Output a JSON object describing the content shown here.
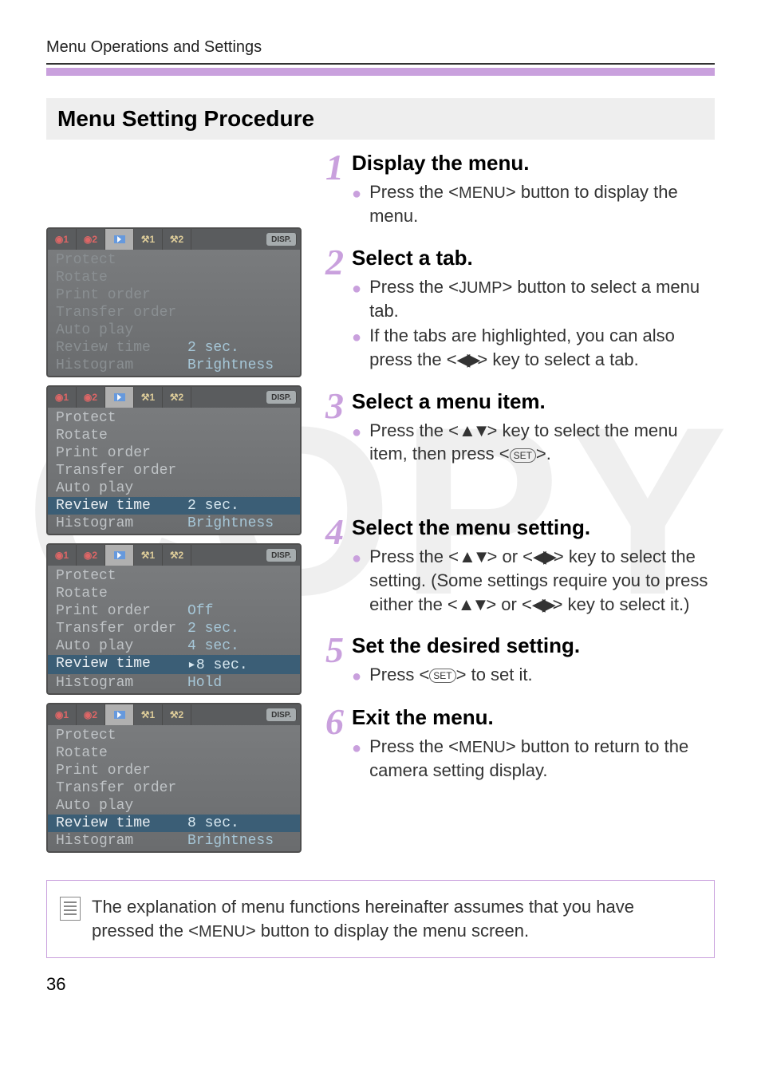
{
  "header": {
    "breadcrumb": "Menu Operations and Settings"
  },
  "section_title": "Menu Setting Procedure",
  "steps": [
    {
      "title": "Display the menu.",
      "bullets": [
        "Press the <MENU> button to display the menu."
      ]
    },
    {
      "title": "Select a tab.",
      "bullets": [
        "Press the <JUMP> button to select a menu tab.",
        "If the tabs are highlighted, you can also press the <◀▶> key to select a tab."
      ]
    },
    {
      "title": "Select a menu item.",
      "bullets": [
        "Press the <▲▼> key to select the menu item, then press <SET>."
      ]
    },
    {
      "title": "Select the menu setting.",
      "bullets": [
        "Press the <▲▼> or <◀▶> key to select the setting. (Some settings require you to press either the <▲▼> or <◀▶> key to select it.)"
      ]
    },
    {
      "title": "Set the desired setting.",
      "bullets": [
        "Press <SET> to set it."
      ]
    },
    {
      "title": "Exit the menu.",
      "bullets": [
        "Press the <MENU> button to return to the camera setting display."
      ]
    }
  ],
  "tabs": {
    "labels": [
      "📷1",
      "📷2",
      "▶",
      "⚙1",
      "⚙2"
    ],
    "disp_label": "DISP."
  },
  "menus": [
    {
      "state": "dim-all",
      "active_tab": 2,
      "items": [
        {
          "label": "Protect",
          "val": ""
        },
        {
          "label": "Rotate",
          "val": ""
        },
        {
          "label": "Print order",
          "val": ""
        },
        {
          "label": "Transfer order",
          "val": ""
        },
        {
          "label": "Auto play",
          "val": ""
        },
        {
          "label": "Review time",
          "val": "2 sec."
        },
        {
          "label": "Histogram",
          "val": "Brightness"
        }
      ],
      "selected": -1
    },
    {
      "state": "",
      "active_tab": 2,
      "items": [
        {
          "label": "Protect",
          "val": ""
        },
        {
          "label": "Rotate",
          "val": ""
        },
        {
          "label": "Print order",
          "val": ""
        },
        {
          "label": "Transfer order",
          "val": ""
        },
        {
          "label": "Auto play",
          "val": ""
        },
        {
          "label": "Review time",
          "val": "2 sec."
        },
        {
          "label": "Histogram",
          "val": "Brightness"
        }
      ],
      "selected": 5
    },
    {
      "state": "",
      "active_tab": 2,
      "items": [
        {
          "label": "Protect",
          "val": ""
        },
        {
          "label": "Rotate",
          "val": ""
        },
        {
          "label": "Print order",
          "val": "Off"
        },
        {
          "label": "Transfer order",
          "val": "2 sec."
        },
        {
          "label": "Auto play",
          "val": "4 sec."
        },
        {
          "label": "Review time",
          "val": "▸8 sec."
        },
        {
          "label": "Histogram",
          "val": "Hold"
        }
      ],
      "selected": 5,
      "vals_highlight": true
    },
    {
      "state": "",
      "active_tab": 2,
      "items": [
        {
          "label": "Protect",
          "val": ""
        },
        {
          "label": "Rotate",
          "val": ""
        },
        {
          "label": "Print order",
          "val": ""
        },
        {
          "label": "Transfer order",
          "val": ""
        },
        {
          "label": "Auto play",
          "val": ""
        },
        {
          "label": "Review time",
          "val": "8 sec."
        },
        {
          "label": "Histogram",
          "val": "Brightness"
        }
      ],
      "selected": 5
    }
  ],
  "footer_note": "The explanation of menu functions hereinafter assumes that you have pressed the <MENU> button to display the menu screen.",
  "page_number": "36",
  "glyphs": {
    "menu": "MENU",
    "jump": "JUMP",
    "set": "SET",
    "updown": "▲▼",
    "leftright": "◀▶"
  }
}
